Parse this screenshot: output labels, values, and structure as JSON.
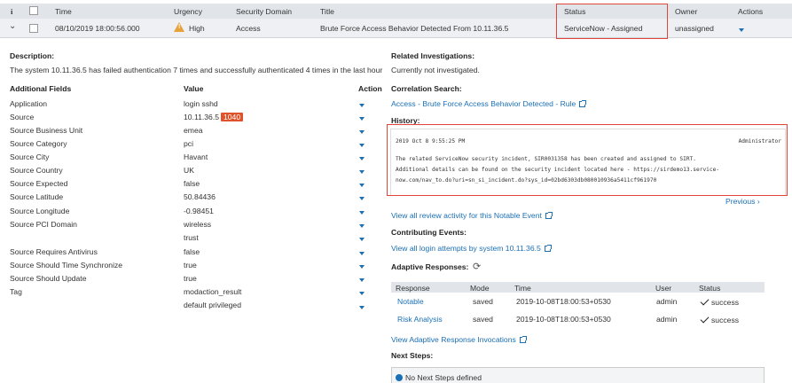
{
  "table": {
    "headers": [
      "i",
      "Time",
      "Urgency",
      "Security Domain",
      "Title",
      "Status",
      "Owner",
      "Actions"
    ],
    "row": {
      "time": "08/10/2019 18:00:56.000",
      "urgency": "High",
      "urgency_icon": "warning-icon",
      "domain": "Access",
      "title": "Brute Force Access Behavior Detected From 10.11.36.5",
      "status": "ServiceNow - Assigned",
      "owner": "unassigned"
    }
  },
  "description": {
    "label": "Description:",
    "text": "The system 10.11.36.5 has failed authentication 7 times and successfully authenticated 4 times in the last hour"
  },
  "fields": {
    "headers": {
      "field": "Additional Fields",
      "value": "Value",
      "action": "Action"
    },
    "rows": [
      {
        "name": "Application",
        "value": "login sshd",
        "badge": ""
      },
      {
        "name": "Source",
        "value": "10.11.36.5",
        "badge": "1040"
      },
      {
        "name": "Source Business Unit",
        "value": "emea",
        "badge": ""
      },
      {
        "name": "Source Category",
        "value": "pci",
        "badge": ""
      },
      {
        "name": "Source City",
        "value": "Havant",
        "badge": ""
      },
      {
        "name": "Source Country",
        "value": "UK",
        "badge": ""
      },
      {
        "name": "Source Expected",
        "value": "false",
        "badge": ""
      },
      {
        "name": "Source Latitude",
        "value": "50.84436",
        "badge": ""
      },
      {
        "name": "Source Longitude",
        "value": "-0.98451",
        "badge": ""
      },
      {
        "name": "Source PCI Domain",
        "value": "wireless",
        "badge": ""
      },
      {
        "name": "",
        "value": "trust",
        "badge": ""
      },
      {
        "name": "Source Requires Antivirus",
        "value": "false",
        "badge": ""
      },
      {
        "name": "Source Should Time Synchronize",
        "value": "true",
        "badge": ""
      },
      {
        "name": "Source Should Update",
        "value": "true",
        "badge": ""
      },
      {
        "name": "Tag",
        "value": "modaction_result",
        "badge": ""
      },
      {
        "name": "",
        "value": "default privileged",
        "badge": ""
      }
    ]
  },
  "right": {
    "related_label": "Related Investigations:",
    "related_text": "Currently not investigated.",
    "correlation_label": "Correlation Search:",
    "correlation_link": "Access - Brute Force Access Behavior Detected - Rule",
    "history_label": "History:",
    "history": {
      "date": "2019 Oct 8 9:55:25 PM",
      "user": "Administrator",
      "lines": [
        "The related ServiceNow security incident, SIR0031358 has been created and assigned to SIRT.",
        "Additional details can be found on the security incident located here - https://sirdemo13.service-",
        "now.com/nav_to.do?uri=sn_si_incident.do?sys_id=02bd6303db080010936a5411cf961970"
      ]
    },
    "previous": "Previous",
    "review_link": "View all review activity for this Notable Event",
    "contributing_label": "Contributing Events:",
    "contributing_link": "View all login attempts by system 10.11.36.5",
    "adaptive_label": "Adaptive Responses:",
    "adaptive_headers": [
      "Response",
      "Mode",
      "Time",
      "User",
      "Status"
    ],
    "adaptive_rows": [
      {
        "response": "Notable",
        "mode": "saved",
        "time": "2019-10-08T18:00:53+0530",
        "user": "admin",
        "status": "success"
      },
      {
        "response": "Risk Analysis",
        "mode": "saved",
        "time": "2019-10-08T18:00:53+0530",
        "user": "admin",
        "status": "success"
      }
    ],
    "invocations_link": "View Adaptive Response Invocations",
    "next_steps_label": "Next Steps:",
    "next_steps_text": "No Next Steps defined"
  }
}
